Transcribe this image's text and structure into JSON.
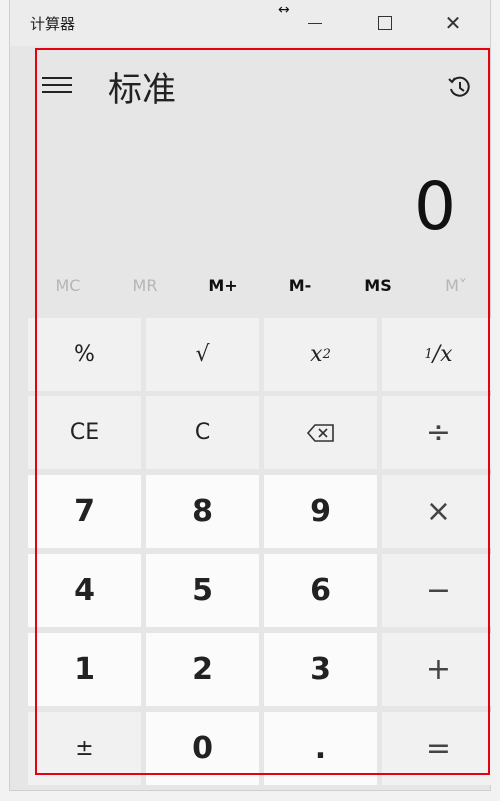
{
  "window": {
    "title": "计算器",
    "resize_glyph": "↔",
    "close_glyph": "✕"
  },
  "header": {
    "mode": "标准",
    "menu_icon": "hamburger-menu-icon",
    "history_icon": "history-icon"
  },
  "display": {
    "value": "0"
  },
  "memory": {
    "buttons": [
      {
        "label": "MC",
        "enabled": false
      },
      {
        "label": "MR",
        "enabled": false
      },
      {
        "label": "M+",
        "enabled": true
      },
      {
        "label": "M-",
        "enabled": true
      },
      {
        "label": "MS",
        "enabled": true
      },
      {
        "label": "M˅",
        "enabled": false
      }
    ]
  },
  "keys": {
    "percent": "%",
    "sqrt": "√",
    "square_base": "x",
    "square_exp": "2",
    "reciprocal_num": "1",
    "reciprocal_den": "x",
    "ce": "CE",
    "c": "C",
    "backspace_icon": "backspace-icon",
    "divide": "÷",
    "seven": "7",
    "eight": "8",
    "nine": "9",
    "multiply": "×",
    "four": "4",
    "five": "5",
    "six": "6",
    "minus": "−",
    "one": "1",
    "two": "2",
    "three": "3",
    "plus": "+",
    "negate": "±",
    "zero": "0",
    "decimal": ".",
    "equals": "="
  }
}
